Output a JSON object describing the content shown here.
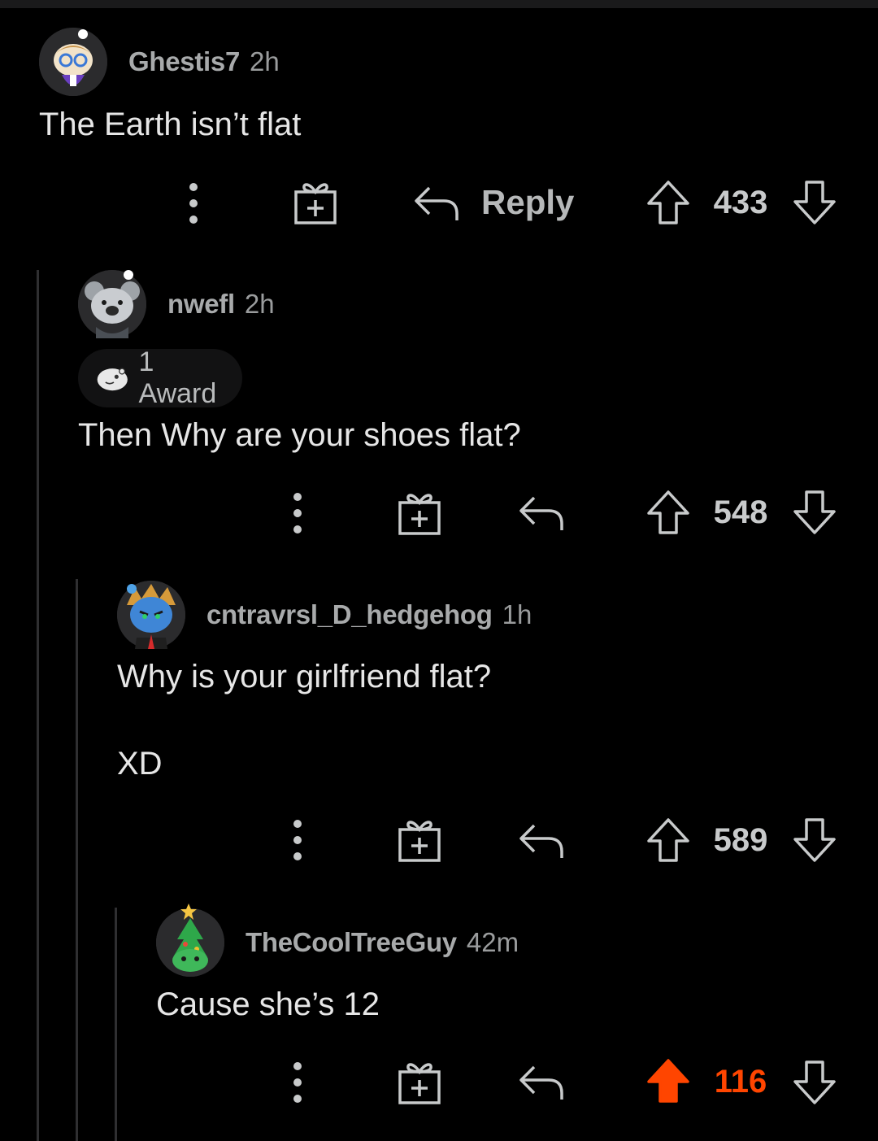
{
  "theme": {
    "background": "#000000",
    "text": "#e6e6e6",
    "muted": "#a8aaab",
    "upvote_accent": "#ff4500"
  },
  "comments": [
    {
      "username": "Ghestis7",
      "time": "2h",
      "body": [
        "The Earth isn’t flat"
      ],
      "award": null,
      "actions": {
        "reply_label": "Reply",
        "score": "433",
        "upvoted": false
      },
      "avatar_icon": "snoo-avatar-glasses-icon"
    },
    {
      "username": "nwefl",
      "time": "2h",
      "award": {
        "label": "1 Award",
        "icon": "award-face-icon"
      },
      "body": [
        "Then Why are your shoes flat?"
      ],
      "actions": {
        "reply_label": "",
        "score": "548",
        "upvoted": false
      },
      "avatar_icon": "snoo-avatar-koala-icon"
    },
    {
      "username": "cntravrsl_D_hedgehog",
      "time": "1h",
      "award": null,
      "body": [
        "Why is your girlfriend flat?",
        "XD"
      ],
      "actions": {
        "reply_label": "",
        "score": "589",
        "upvoted": false
      },
      "avatar_icon": "snoo-avatar-hedgehog-icon"
    },
    {
      "username": "TheCoolTreeGuy",
      "time": "42m",
      "award": null,
      "body": [
        "Cause she’s 12"
      ],
      "actions": {
        "reply_label": "",
        "score": "116",
        "upvoted": true
      },
      "avatar_icon": "snoo-avatar-tree-icon"
    }
  ]
}
